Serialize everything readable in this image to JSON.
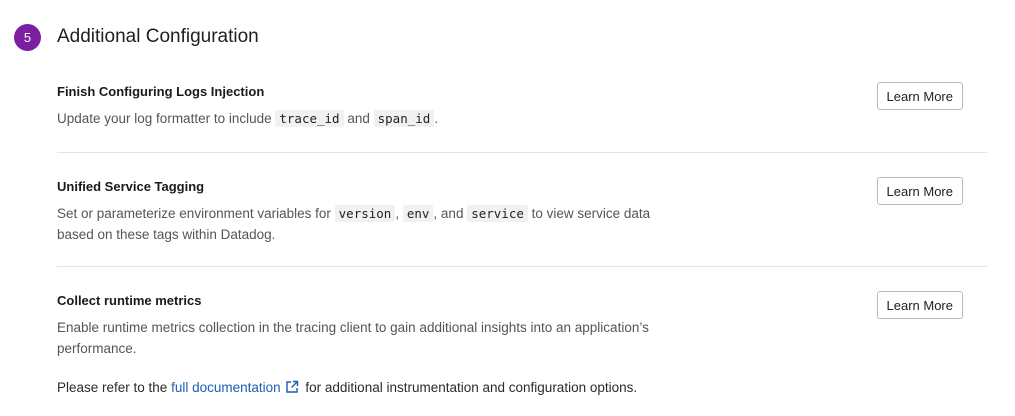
{
  "header": {
    "step_number": "5",
    "title": "Additional Configuration"
  },
  "items": [
    {
      "title": "Finish Configuring Logs Injection",
      "desc_parts": [
        "Update your log formatter to include ",
        "trace_id",
        " and ",
        "span_id",
        "."
      ],
      "button": "Learn More"
    },
    {
      "title": "Unified Service Tagging",
      "desc_parts": [
        "Set or parameterize environment variables for ",
        "version",
        ", ",
        "env",
        ", and ",
        "service",
        " to view service data based on these tags within Datadog."
      ],
      "button": "Learn More"
    },
    {
      "title": "Collect runtime metrics",
      "desc": "Enable runtime metrics collection in the tracing client to gain additional insights into an application’s performance.",
      "button": "Learn More"
    }
  ],
  "footer": {
    "prefix": "Please refer to the ",
    "link": "full documentation",
    "suffix": " for additional instrumentation and configuration options.",
    "link_icon": "external-link-icon"
  }
}
